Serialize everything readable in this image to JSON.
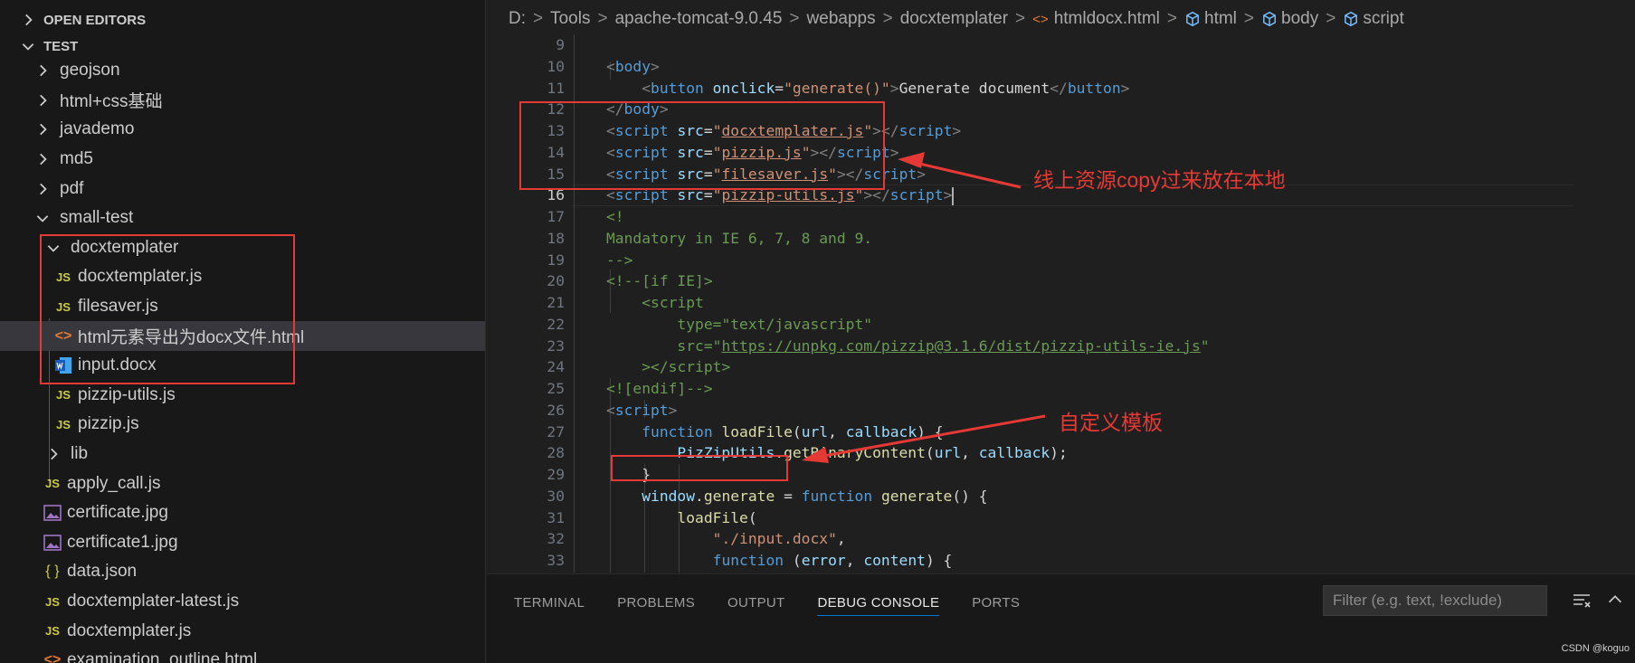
{
  "sidebar": {
    "open_editors_label": "OPEN EDITORS",
    "workspace_label": "TEST",
    "items": [
      {
        "label": "geojson",
        "kind": "folder",
        "open": false
      },
      {
        "label": "html+css基础",
        "kind": "folder",
        "open": false
      },
      {
        "label": "javademo",
        "kind": "folder",
        "open": false
      },
      {
        "label": "md5",
        "kind": "folder",
        "open": false
      },
      {
        "label": "pdf",
        "kind": "folder",
        "open": false
      },
      {
        "label": "small-test",
        "kind": "folder",
        "open": true
      },
      {
        "label": "docxtemplater",
        "kind": "folder",
        "open": true
      },
      {
        "label": "docxtemplater.js",
        "kind": "js"
      },
      {
        "label": "filesaver.js",
        "kind": "js"
      },
      {
        "label": "html元素导出为docx文件.html",
        "kind": "html",
        "selected": true
      },
      {
        "label": "input.docx",
        "kind": "word"
      },
      {
        "label": "pizzip-utils.js",
        "kind": "js"
      },
      {
        "label": "pizzip.js",
        "kind": "js"
      },
      {
        "label": "lib",
        "kind": "folder",
        "open": false
      },
      {
        "label": "apply_call.js",
        "kind": "js"
      },
      {
        "label": "certificate.jpg",
        "kind": "image"
      },
      {
        "label": "certificate1.jpg",
        "kind": "image"
      },
      {
        "label": "data.json",
        "kind": "json"
      },
      {
        "label": "docxtemplater-latest.js",
        "kind": "js"
      },
      {
        "label": "docxtemplater.js",
        "kind": "js"
      },
      {
        "label": "examination_outline.html",
        "kind": "html"
      }
    ],
    "icon_text": {
      "js": "JS",
      "json": "{ }",
      "html": "<>"
    }
  },
  "breadcrumb": [
    "D:",
    "Tools",
    "apache-tomcat-9.0.45",
    "webapps",
    "docxtemplater",
    "htmldocx.html",
    "html",
    "body",
    "script"
  ],
  "editor": {
    "current_line": 16,
    "line_numbers": [
      "9",
      "10",
      "11",
      "12",
      "13",
      "14",
      "15",
      "16",
      "17",
      "18",
      "19",
      "20",
      "21",
      "22",
      "23",
      "24",
      "25",
      "26",
      "27",
      "28",
      "29",
      "30",
      "31",
      "32",
      "33"
    ],
    "code": {
      "body_open": "body",
      "button_tag": "button",
      "onclick_attr": "onclick",
      "onclick_val": "\"generate()\"",
      "button_text": "Generate document",
      "script_tag": "script",
      "src_attr": "src",
      "src1": "docxtemplater.js",
      "src2": "pizzip.js",
      "src3": "filesaver.js",
      "src4": "pizzip-utils.js",
      "comment_open": "<!",
      "comment_text": "Mandatory in IE 6, 7, 8 and 9.",
      "comment_close": "-->",
      "ifie": "<!--[if IE]>",
      "type_attr": "type",
      "type_val": "\"text/javascript\"",
      "src_url": "https://unpkg.com/pizzip@3.1.6/dist/pizzip-utils-ie.js",
      "endif": "<![endif]-->",
      "function_kw": "function",
      "loadfile_fn": "loadFile",
      "url_param": "url",
      "callback_param": "callback",
      "pizziputils": "PizZipUtils",
      "getbinary": "getBinaryContent",
      "window_obj": "window",
      "generate_prop": "generate",
      "generate_fn": "generate",
      "input_path": "\"./input.docx\"",
      "error_param": "error",
      "content_param": "content"
    }
  },
  "annotations": {
    "note1": "线上资源copy过来放在本地",
    "note2": "自定义模板"
  },
  "panel": {
    "tabs": [
      "TERMINAL",
      "PROBLEMS",
      "OUTPUT",
      "DEBUG CONSOLE",
      "PORTS"
    ],
    "active_tab": "DEBUG CONSOLE",
    "filter_placeholder": "Filter (e.g. text, !exclude)"
  },
  "watermark": "CSDN @koguo",
  "colors": {
    "annotation_red": "#e53935",
    "accent_blue": "#0078d4",
    "editor_bg": "#1f1f1f",
    "sidebar_bg": "#181818"
  }
}
